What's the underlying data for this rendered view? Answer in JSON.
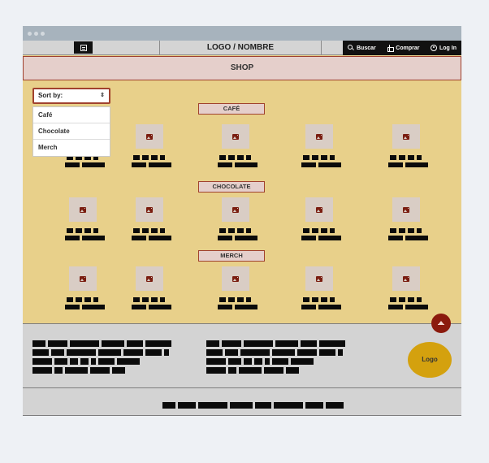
{
  "navbar": {
    "logo_text": "LOGO / NOMBRE",
    "menu_icon": "menu-icon",
    "actions": [
      {
        "label": "Buscar",
        "icon": "search-icon"
      },
      {
        "label": "Comprar",
        "icon": "gift-icon"
      },
      {
        "label": "Log In",
        "icon": "user-icon"
      }
    ]
  },
  "shop": {
    "title": "SHOP"
  },
  "sort": {
    "label": "Sort by:",
    "options": [
      "Café",
      "Chocolate",
      "Merch"
    ]
  },
  "categories": [
    {
      "label": "CAFÉ"
    },
    {
      "label": "CHOCOLATE"
    },
    {
      "label": "MERCH"
    }
  ],
  "products_per_category": 5,
  "footer": {
    "logo_text": "Logo"
  },
  "colors": {
    "page_bg": "#e8d08a",
    "accent": "#a0412e",
    "logo_badge": "#d4a10e",
    "scroll_top_button": "#8b1a0d",
    "footer_bg": "#d3d3d3"
  }
}
